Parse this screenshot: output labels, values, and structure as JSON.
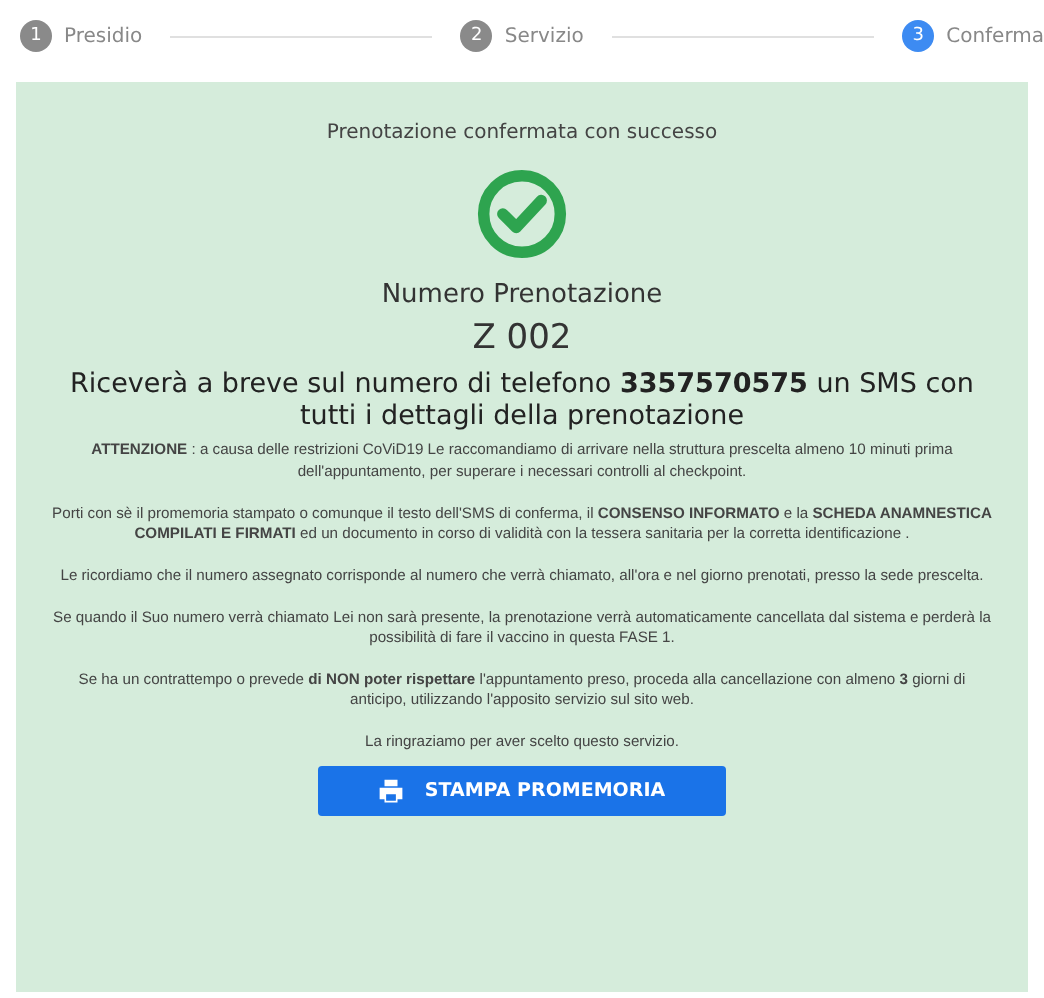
{
  "steps": [
    {
      "number": "1",
      "label": "Presidio",
      "selected": false
    },
    {
      "number": "2",
      "label": "Servizio",
      "selected": false
    },
    {
      "number": "3",
      "label": "Conferma",
      "selected": true
    }
  ],
  "confirmation": {
    "status": "Prenotazione confermata con successo",
    "heading": "Numero Prenotazione",
    "booking_number": "Z 002",
    "sms_notice": "Riceverà a breve sul numero di telefono **3357570575** un SMS con tutti i dettagli della prenotazione",
    "paragraphs": [
      "**ATTENZIONE** : a causa delle restrizioni CoViD19 Le raccomandiamo di arrivare nella struttura prescelta almeno 10 minuti prima dell'appuntamento, per superare i necessari controlli al checkpoint.",
      "Porti con sè il promemoria stampato o comunque il testo dell'SMS di conferma, il **CONSENSO INFORMATO** e la **SCHEDA ANAMNESTICA COMPILATI E FIRMATI** ed un documento in corso di validità con la  tessera sanitaria per la corretta identificazione .",
      "Le ricordiamo che il numero assegnato corrisponde al numero che verrà chiamato, all'ora e nel giorno prenotati, presso la sede prescelta.",
      "Se quando il Suo numero verrà chiamato Lei non sarà presente, la prenotazione verrà automaticamente cancellata dal sistema e perderà la possibilità di fare il vaccino in questa FASE 1.",
      "Se ha un contrattempo o prevede **di NON poter rispettare** l'appuntamento preso, proceda alla cancellazione con almeno **3** giorni di anticipo, utilizzando l'apposito servizio sul sito web.",
      "La ringraziamo per aver scelto questo servizio."
    ],
    "print_button": "STAMPA PROMEMORIA"
  }
}
